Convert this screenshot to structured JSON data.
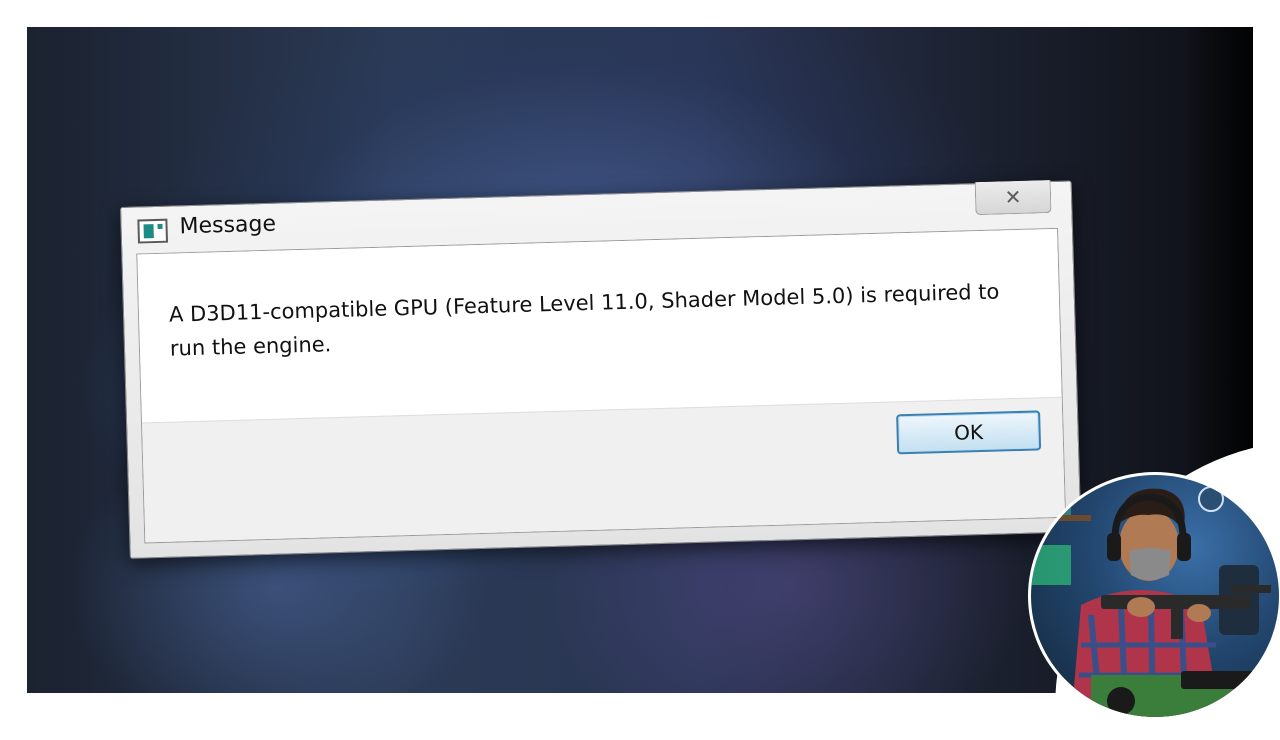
{
  "dialog": {
    "title": "Message",
    "close_glyph": "✕",
    "message": "A D3D11-compatible GPU (Feature Level 11.0, Shader Model 5.0) is required to run the engine.",
    "ok_label": "OK"
  },
  "icons": {
    "app": "app-window-icon",
    "close": "close-icon"
  },
  "colors": {
    "ok_border": "#3c7fb1",
    "icon_accent": "#1b8c86"
  }
}
